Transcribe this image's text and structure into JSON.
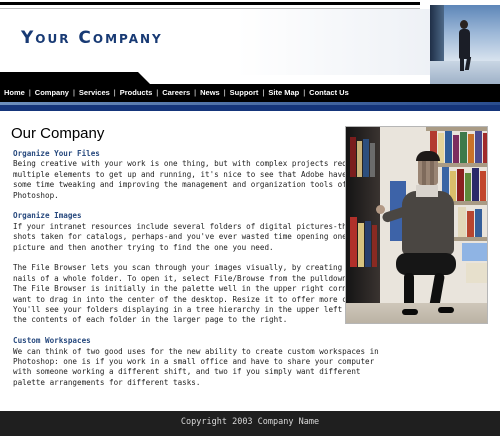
{
  "header": {
    "logo_text": "Your Company"
  },
  "nav": {
    "items": [
      {
        "label": "Home"
      },
      {
        "label": "Company"
      },
      {
        "label": "Services"
      },
      {
        "label": "Products"
      },
      {
        "label": "Careers"
      },
      {
        "label": "News"
      },
      {
        "label": "Support"
      },
      {
        "label": "Site Map"
      },
      {
        "label": "Contact Us"
      }
    ],
    "separator": "|"
  },
  "main": {
    "title": "Our Company",
    "sections": [
      {
        "heading": "Organize Your Files",
        "lines": [
          "Being creative with your work is one thing, but with complex projects requiring",
          "multiple elements to get up and running, it's nice to see that Adobe have spent",
          "some time tweaking and improving the management and organization tools of",
          "Photoshop."
        ]
      },
      {
        "heading": "Organize Images",
        "lines": [
          "If your intranet resources include several folders of digital pictures-thousands of",
          "shots taken for catalogs, perhaps-and you've ever wasted time opening one",
          "picture and then another trying to find the one you need.",
          "",
          "The File Browser lets you scan through your images visually, by creating thumb-",
          "nails of a whole folder. To open it, select File/Browse from the pulldown menu.",
          "The File Browser is initially in the palette well in the upper right corner, so you'll",
          "want to drag in into the center of the desktop. Resize it to offer more coverage.",
          "You'll see your folders displaying in a tree hierarchy in the upper left corner, with",
          "the contents of each folder in the larger page to the right."
        ]
      },
      {
        "heading": "Custom Workspaces",
        "lines": [
          "We can think of two good uses for the new ability to create custom workspaces in",
          "Photoshop: one is if you work in a small office and have to share your computer",
          "with someone working a different shift, and two if you simply want different",
          "palette arrangements for different tasks."
        ]
      }
    ]
  },
  "footer": {
    "copyright": "Copyright 2003 Company Name"
  },
  "colors": {
    "brand_navy": "#183a74",
    "heading_blue": "#27497e",
    "nav_bg": "#000000",
    "accent_bar": "#15357a",
    "footer_bg": "#1f1f1f"
  },
  "icons": {
    "header_photo": "person-walking-photo",
    "side_photo": "woman-at-bookshelf-photo"
  }
}
